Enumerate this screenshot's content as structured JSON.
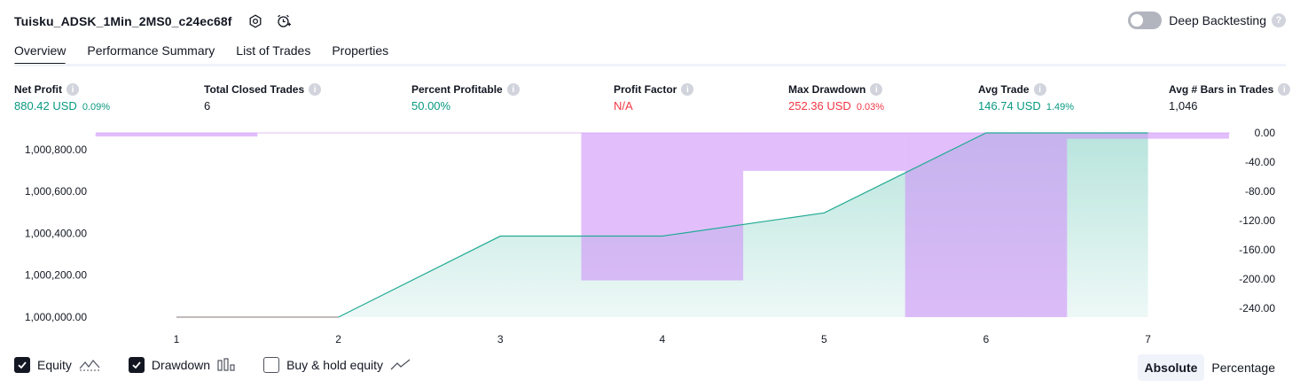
{
  "header": {
    "title": "Tuisku_ADSK_1Min_2MS0_c24ec68f",
    "settings_icon": "settings-gear-icon",
    "alert_icon": "add-alert-icon"
  },
  "deep_backtesting": {
    "label": "Deep Backtesting",
    "enabled": false,
    "help": "?"
  },
  "tabs": [
    {
      "label": "Overview",
      "active": true
    },
    {
      "label": "Performance Summary",
      "active": false
    },
    {
      "label": "List of Trades",
      "active": false
    },
    {
      "label": "Properties",
      "active": false
    }
  ],
  "metrics": {
    "net_profit": {
      "label": "Net Profit",
      "value": "880.42 USD",
      "pct": "0.09%",
      "info": "i"
    },
    "total_closed_trades": {
      "label": "Total Closed Trades",
      "value": "6",
      "info": "i"
    },
    "percent_profitable": {
      "label": "Percent Profitable",
      "value": "50.00%",
      "info": "i"
    },
    "profit_factor": {
      "label": "Profit Factor",
      "value": "N/A",
      "info": "i"
    },
    "max_drawdown": {
      "label": "Max Drawdown",
      "value": "252.36 USD",
      "pct": "0.03%",
      "info": "i"
    },
    "avg_trade": {
      "label": "Avg Trade",
      "value": "146.74 USD",
      "pct": "1.49%",
      "info": "i"
    },
    "avg_bars": {
      "label": "Avg # Bars in Trades",
      "value": "1,046",
      "info": "i"
    }
  },
  "colors": {
    "equity_line": "#22ab94",
    "equity_fill": "#22ab94",
    "drawdown_fill": "#ce93f8",
    "positive": "#089981",
    "negative": "#f23645"
  },
  "chart_data": {
    "type": "area",
    "x": [
      1,
      2,
      3,
      4,
      5,
      6,
      7
    ],
    "left_axis_ticks": [
      "1,000,800.00",
      "1,000,600.00",
      "1,000,400.00",
      "1,000,200.00",
      "1,000,000.00"
    ],
    "right_axis_ticks": [
      "0.00",
      "-40.00",
      "-80.00",
      "-120.00",
      "-160.00",
      "-200.00",
      "-240.00"
    ],
    "x_tick_labels": [
      "1",
      "2",
      "3",
      "4",
      "5",
      "6",
      "7"
    ],
    "ylim_left": [
      1000000,
      1000880
    ],
    "ylim_right": [
      -252.36,
      0
    ],
    "series": [
      {
        "name": "Equity",
        "values": [
          1000000,
          1000000,
          1000387,
          1000387,
          1000498,
          1000880,
          1000880
        ]
      },
      {
        "name": "Drawdown",
        "values": [
          -5,
          0,
          0,
          -202,
          -52,
          -252.36,
          -8
        ]
      }
    ],
    "grid": false
  },
  "legend": {
    "equity": {
      "label": "Equity",
      "checked": true,
      "icon": "equity-line-icon"
    },
    "drawdown": {
      "label": "Drawdown",
      "checked": true,
      "icon": "drawdown-bars-icon"
    },
    "buy_hold": {
      "label": "Buy & hold equity",
      "checked": false,
      "icon": "buy-hold-line-icon"
    }
  },
  "mode": {
    "absolute": "Absolute",
    "percentage": "Percentage",
    "selected": "Absolute"
  }
}
